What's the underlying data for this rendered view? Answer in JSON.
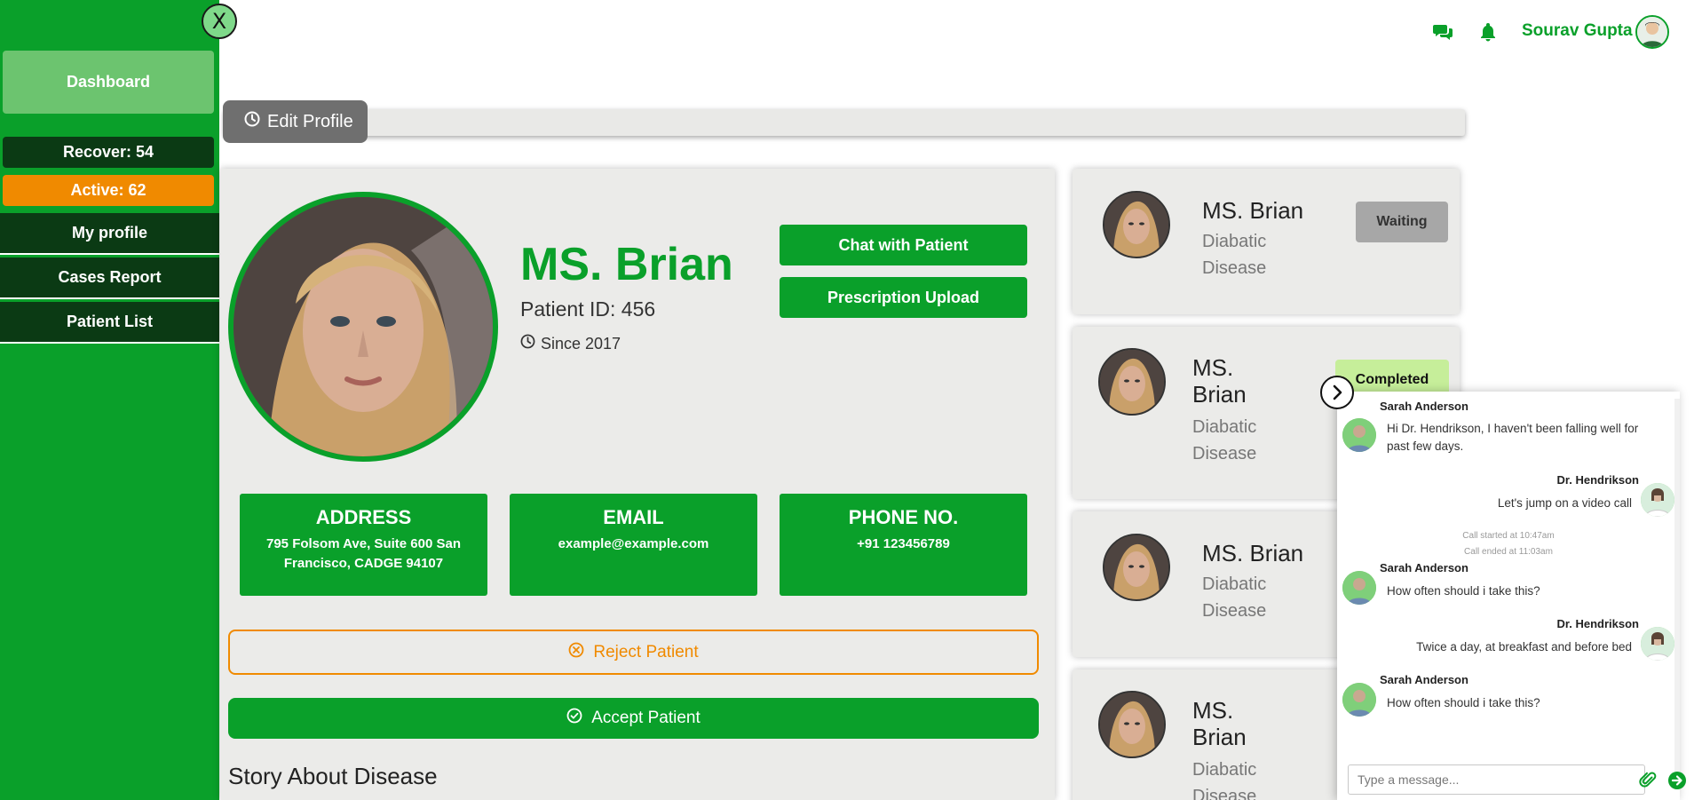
{
  "sidebar": {
    "close_label": "X",
    "dashboard_label": "Dashboard",
    "recover_label": "Recover: 54",
    "active_label": "Active: 62",
    "nav": [
      {
        "label": "My profile"
      },
      {
        "label": "Cases Report"
      },
      {
        "label": "Patient List"
      }
    ]
  },
  "header": {
    "icons": [
      "chat-icon",
      "bell-icon"
    ],
    "user_name": "Sourav Gupta"
  },
  "toolbar": {
    "edit_profile_label": "Edit Profile"
  },
  "patient": {
    "name": "MS. Brian",
    "id_text": "Patient ID: 456",
    "since_text": "Since 2017",
    "chat_button": "Chat with Patient",
    "prescription_button": "Prescription Upload",
    "address_title": "ADDRESS",
    "address_value": "795 Folsom Ave, Suite 600 San Francisco, CADGE 94107",
    "email_title": "EMAIL",
    "email_value": "example@example.com",
    "phone_title": "PHONE NO.",
    "phone_value": "+91 123456789",
    "reject_label": "Reject Patient",
    "accept_label": "Accept Patient",
    "story_title": "Story About Disease"
  },
  "patient_list": [
    {
      "name": "MS. Brian",
      "disease": "Diabatic Disease",
      "status": "Waiting",
      "status_color": "#a7a7a7"
    },
    {
      "name": "MS. Brian",
      "disease": "Diabatic Disease",
      "status": "Completed",
      "status_color": "#c6ee9a"
    },
    {
      "name": "MS. Brian",
      "disease": "Diabatic Disease"
    },
    {
      "name": "MS. Brian",
      "disease": "Diabatic Disease"
    }
  ],
  "chat": {
    "messages": [
      {
        "sender": "Sarah Anderson",
        "text": "Hi Dr. Hendrikson, I haven't been falling well for past few days."
      },
      {
        "sender": "Dr. Hendrikson",
        "text": "Let's jump on a video call"
      },
      {
        "sender": "Sarah Anderson",
        "text": "How often should i take this?"
      },
      {
        "sender": "Dr. Hendrikson",
        "text": "Twice a day, at breakfast and before bed"
      },
      {
        "sender": "Sarah Anderson",
        "text": "How often should i take this?"
      }
    ],
    "call_started": "Call started at 10:47am",
    "call_ended": "Call ended at 11:03am",
    "input_placeholder": "Type a message..."
  },
  "colors": {
    "brand_green": "#0aa02a",
    "dark_green": "#0b3a14",
    "orange": "#f08a00"
  }
}
